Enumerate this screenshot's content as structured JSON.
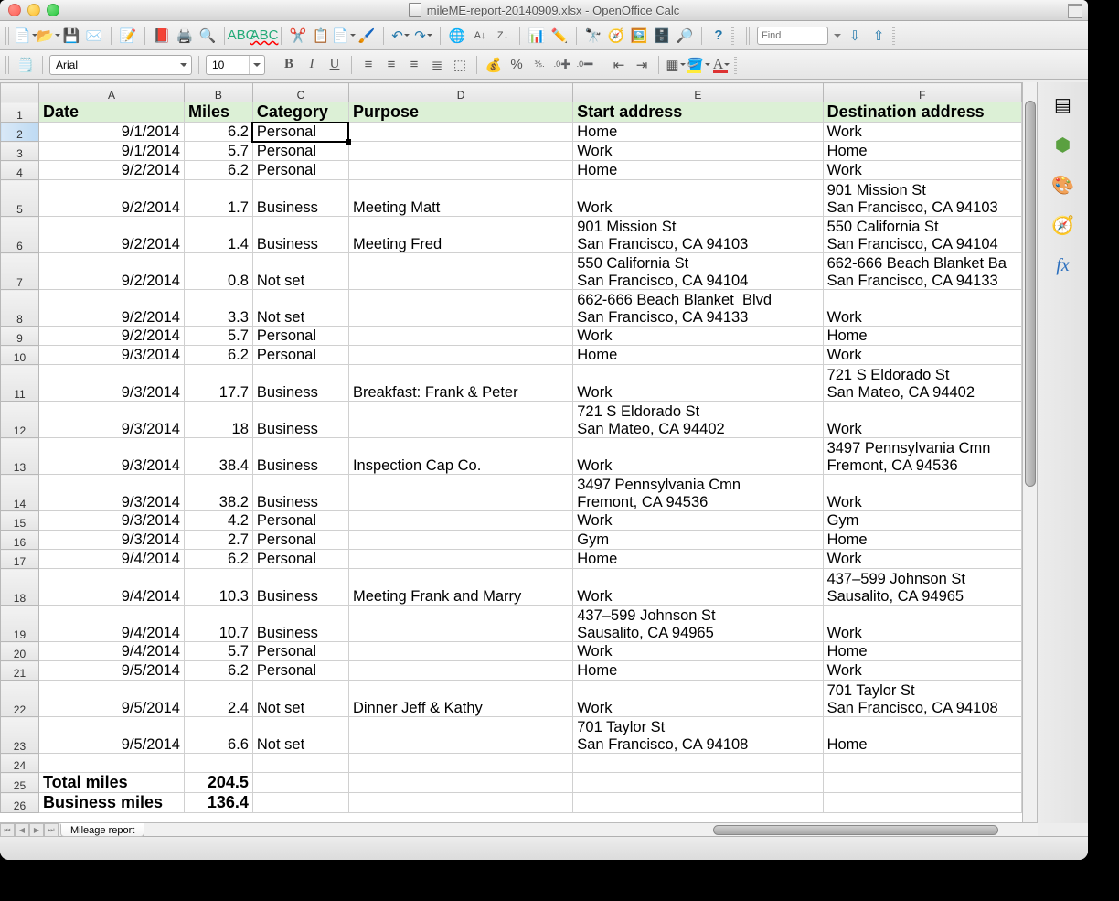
{
  "window": {
    "title": "mileME-report-20140909.xlsx - OpenOffice Calc"
  },
  "find_placeholder": "Find",
  "font_name": "Arial",
  "font_size": "10",
  "columns": [
    "A",
    "B",
    "C",
    "D",
    "E",
    "F"
  ],
  "selected_cell": "C2",
  "headers": {
    "A": "Date",
    "B": "Miles",
    "C": "Category",
    "D": "Purpose",
    "E": "Start address",
    "F": "Destination address"
  },
  "rows": [
    {
      "n": 2,
      "tall": false,
      "A": "9/1/2014",
      "B": "6.2",
      "C": "Personal",
      "D": "",
      "E": "Home",
      "F": "Work"
    },
    {
      "n": 3,
      "tall": false,
      "A": "9/1/2014",
      "B": "5.7",
      "C": "Personal",
      "D": "",
      "E": "Work",
      "F": "Home"
    },
    {
      "n": 4,
      "tall": false,
      "A": "9/2/2014",
      "B": "6.2",
      "C": "Personal",
      "D": "",
      "E": "Home",
      "F": "Work"
    },
    {
      "n": 5,
      "tall": true,
      "A": "9/2/2014",
      "B": "1.7",
      "C": "Business",
      "D": "Meeting Matt",
      "E": "Work",
      "F": "901 Mission St\nSan Francisco, CA 94103"
    },
    {
      "n": 6,
      "tall": true,
      "A": "9/2/2014",
      "B": "1.4",
      "C": "Business",
      "D": "Meeting Fred",
      "E": "901 Mission St\nSan Francisco, CA 94103",
      "F": "550 California St\nSan Francisco, CA 94104"
    },
    {
      "n": 7,
      "tall": true,
      "A": "9/2/2014",
      "B": "0.8",
      "C": "Not set",
      "D": "",
      "E": "550 California St\nSan Francisco, CA 94104",
      "F": "662-666 Beach Blanket Ba\nSan Francisco, CA 94133"
    },
    {
      "n": 8,
      "tall": true,
      "A": "9/2/2014",
      "B": "3.3",
      "C": "Not set",
      "D": "",
      "E": "662-666 Beach Blanket  Blvd\nSan Francisco, CA 94133",
      "F": "Work"
    },
    {
      "n": 9,
      "tall": false,
      "A": "9/2/2014",
      "B": "5.7",
      "C": "Personal",
      "D": "",
      "E": "Work",
      "F": "Home"
    },
    {
      "n": 10,
      "tall": false,
      "A": "9/3/2014",
      "B": "6.2",
      "C": "Personal",
      "D": "",
      "E": "Home",
      "F": "Work"
    },
    {
      "n": 11,
      "tall": true,
      "A": "9/3/2014",
      "B": "17.7",
      "C": "Business",
      "D": "Breakfast: Frank & Peter",
      "E": "Work",
      "F": "721 S Eldorado St\nSan Mateo, CA 94402"
    },
    {
      "n": 12,
      "tall": true,
      "A": "9/3/2014",
      "B": "18",
      "C": "Business",
      "D": "",
      "E": "721 S Eldorado St\nSan Mateo, CA 94402",
      "F": "Work"
    },
    {
      "n": 13,
      "tall": true,
      "A": "9/3/2014",
      "B": "38.4",
      "C": "Business",
      "D": "Inspection Cap Co.",
      "E": "Work",
      "F": "3497 Pennsylvania Cmn\nFremont, CA 94536"
    },
    {
      "n": 14,
      "tall": true,
      "A": "9/3/2014",
      "B": "38.2",
      "C": "Business",
      "D": "",
      "E": "3497 Pennsylvania Cmn\nFremont, CA 94536",
      "F": "Work"
    },
    {
      "n": 15,
      "tall": false,
      "A": "9/3/2014",
      "B": "4.2",
      "C": "Personal",
      "D": "",
      "E": "Work",
      "F": "Gym"
    },
    {
      "n": 16,
      "tall": false,
      "A": "9/3/2014",
      "B": "2.7",
      "C": "Personal",
      "D": "",
      "E": "Gym",
      "F": "Home"
    },
    {
      "n": 17,
      "tall": false,
      "A": "9/4/2014",
      "B": "6.2",
      "C": "Personal",
      "D": "",
      "E": "Home",
      "F": "Work"
    },
    {
      "n": 18,
      "tall": true,
      "A": "9/4/2014",
      "B": "10.3",
      "C": "Business",
      "D": "Meeting Frank and Marry",
      "E": "Work",
      "F": "437–599 Johnson St\nSausalito, CA 94965"
    },
    {
      "n": 19,
      "tall": true,
      "A": "9/4/2014",
      "B": "10.7",
      "C": "Business",
      "D": "",
      "E": "437–599 Johnson St\nSausalito, CA 94965",
      "F": "Work"
    },
    {
      "n": 20,
      "tall": false,
      "A": "9/4/2014",
      "B": "5.7",
      "C": "Personal",
      "D": "",
      "E": "Work",
      "F": "Home"
    },
    {
      "n": 21,
      "tall": false,
      "A": "9/5/2014",
      "B": "6.2",
      "C": "Personal",
      "D": "",
      "E": "Home",
      "F": "Work"
    },
    {
      "n": 22,
      "tall": true,
      "A": "9/5/2014",
      "B": "2.4",
      "C": "Not set",
      "D": "Dinner Jeff & Kathy",
      "E": "Work",
      "F": "701 Taylor St\nSan Francisco, CA 94108"
    },
    {
      "n": 23,
      "tall": true,
      "A": "9/5/2014",
      "B": "6.6",
      "C": "Not set",
      "D": "",
      "E": "701 Taylor St\nSan Francisco, CA 94108",
      "F": "Home"
    }
  ],
  "summary": [
    {
      "n": 24,
      "A": "",
      "B": ""
    },
    {
      "n": 25,
      "A": "Total miles",
      "B": "204.5"
    },
    {
      "n": 26,
      "A": "Business miles",
      "B": "136.4"
    }
  ],
  "sheet_tab": "Mileage report"
}
